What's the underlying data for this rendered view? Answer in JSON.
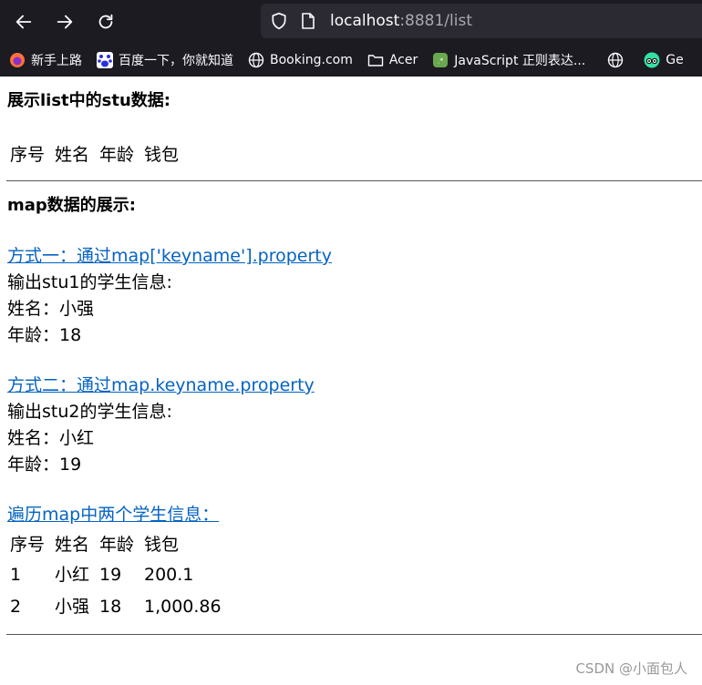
{
  "browser": {
    "url_host": "localhost",
    "url_rest": ":8881/list",
    "bookmarks": [
      {
        "label": "新手上路",
        "icon": "firefox-icon"
      },
      {
        "label": "百度一下，你就知道",
        "icon": "baidu-paw-icon"
      },
      {
        "label": "Booking.com",
        "icon": "globe-icon"
      },
      {
        "label": "Acer",
        "icon": "folder-icon"
      },
      {
        "label": "JavaScript 正则表达...",
        "icon": "js-regex-icon"
      },
      {
        "label": "",
        "icon": "globe-icon"
      },
      {
        "label": "Ge",
        "icon": "tripadvisor-icon"
      }
    ]
  },
  "page": {
    "list_heading": "展示list中的stu数据:",
    "list_table": {
      "headers": [
        "序号",
        "姓名",
        "年龄",
        "钱包"
      ]
    },
    "map_heading": "map数据的展示:",
    "method1": {
      "link": "方式一：通过map['keyname'].property",
      "intro": "输出stu1的学生信息:",
      "name_line": "姓名：小强",
      "age_line": "年龄：18"
    },
    "method2": {
      "link": "方式二：通过map.keyname.property",
      "intro": "输出stu2的学生信息:",
      "name_line": "姓名：小红",
      "age_line": "年龄：19"
    },
    "loop": {
      "link": "遍历map中两个学生信息：",
      "headers": [
        "序号",
        "姓名",
        "年龄",
        "钱包"
      ],
      "rows": [
        [
          "1",
          "小红",
          "19",
          "200.1"
        ],
        [
          "2",
          "小强",
          "18",
          "1,000.86"
        ]
      ]
    },
    "watermark": "CSDN @小面包人"
  }
}
